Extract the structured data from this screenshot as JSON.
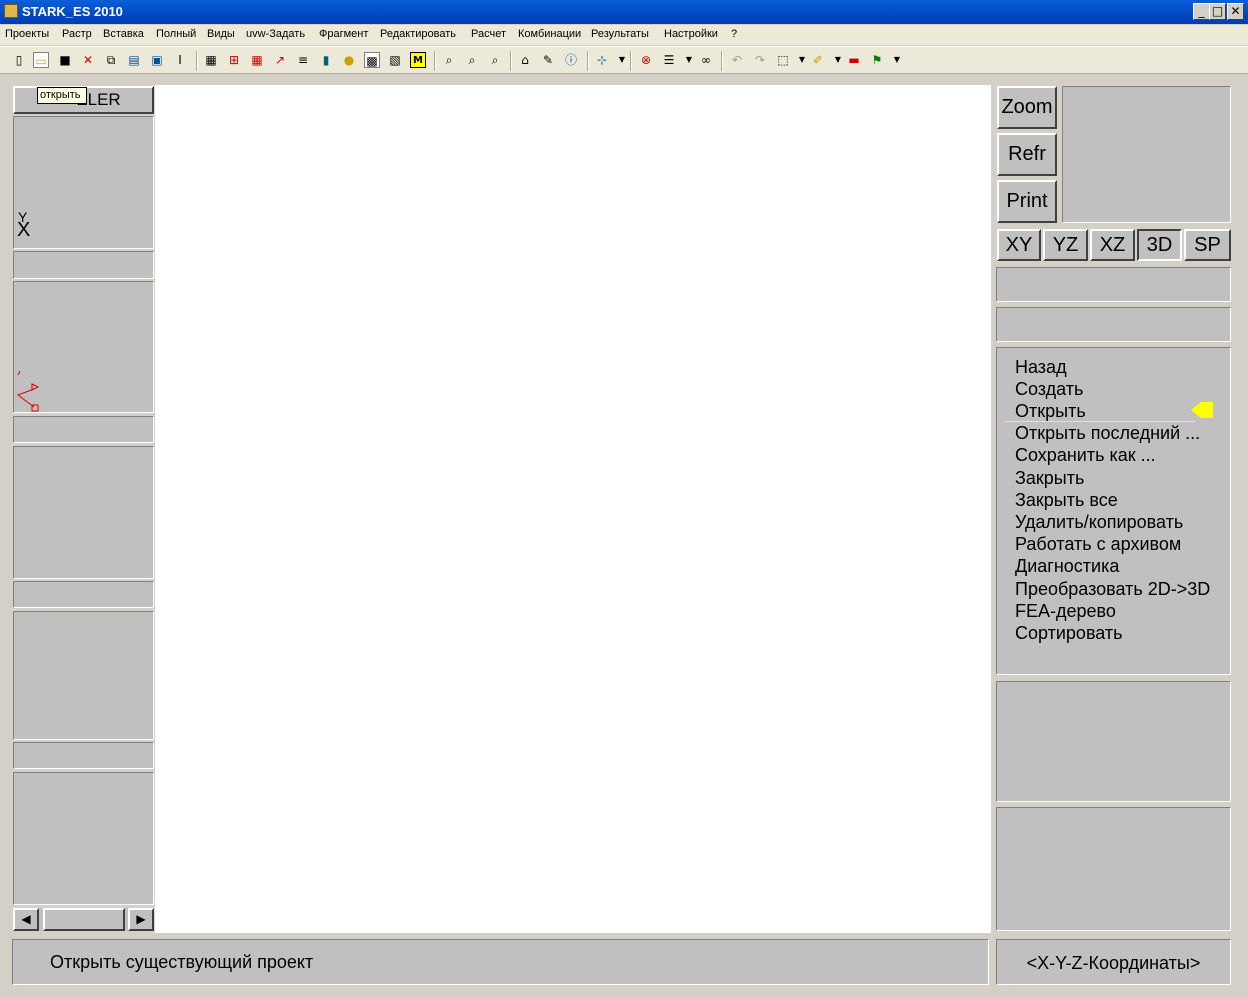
{
  "window": {
    "title": "STARK_ES 2010",
    "controls": [
      "_",
      "□",
      "✕"
    ]
  },
  "menu": [
    "Проекты",
    "Растр",
    "Вставка",
    "Полный",
    "Виды",
    "uvw-Задать",
    "Фрагмент",
    "Редактировать",
    "Расчет",
    "Комбинации",
    "Результаты",
    "Настройки",
    "?"
  ],
  "tooltip": "открыть",
  "left_panel": {
    "header_label": "ELER",
    "axis_y": "Y",
    "axis_x": "X"
  },
  "right_panel": {
    "buttons": {
      "zoom": "Zoom",
      "refresh": "Refr",
      "print": "Print"
    },
    "views": [
      {
        "label": "XY",
        "active": false
      },
      {
        "label": "YZ",
        "active": false
      },
      {
        "label": "XZ",
        "active": false
      },
      {
        "label": "3D",
        "active": true
      },
      {
        "label": "SP",
        "active": false
      }
    ],
    "menu_items": [
      "Назад",
      "Создать",
      "Открыть",
      "Открыть последний ...",
      "Сохранить как ...",
      "Закрыть",
      "Закрыть все",
      "Удалить/копировать",
      "Работать с архивом",
      "Диагностика",
      "Преобразовать 2D->3D",
      "FEA-дерево",
      "Сортировать"
    ],
    "selected_index": 2,
    "highlight_color": "#ffff00"
  },
  "status": {
    "message": "Открыть существующий проект",
    "coordinates": "<X-Y-Z-Координаты>"
  },
  "scrollbar": {
    "left_arrow": "◀",
    "right_arrow": "▶"
  }
}
